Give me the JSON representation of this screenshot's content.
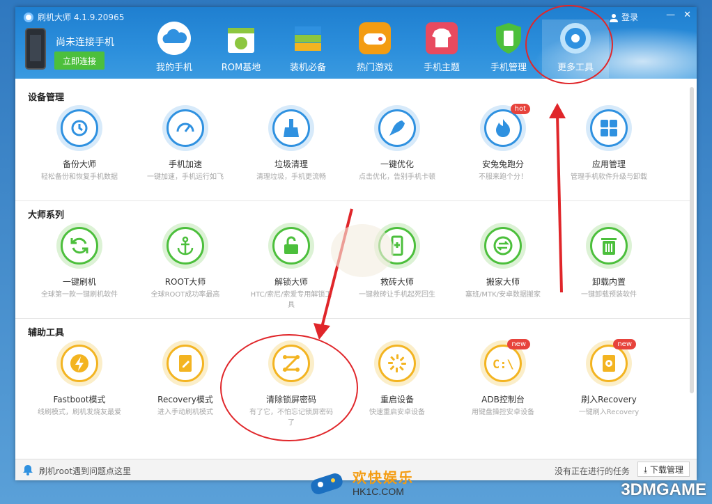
{
  "window": {
    "title": "刷机大师 4.1.9.20965",
    "login": "登录"
  },
  "device": {
    "status": "尚未连接手机",
    "connect_label": "立即连接"
  },
  "nav": [
    {
      "label": "我的手机",
      "icon": "cloud-icon"
    },
    {
      "label": "ROM基地",
      "icon": "rom-bag-icon"
    },
    {
      "label": "装机必备",
      "icon": "books-icon"
    },
    {
      "label": "热门游戏",
      "icon": "gamepad-icon"
    },
    {
      "label": "手机主题",
      "icon": "tshirt-icon"
    },
    {
      "label": "手机管理",
      "icon": "phone-shield-icon"
    },
    {
      "label": "更多工具",
      "icon": "wrench-icon"
    }
  ],
  "sections": [
    {
      "title": "设备管理",
      "color": "#2f91e0",
      "tools": [
        {
          "name": "备份大师",
          "desc": "轻松备份和恢复手机数据",
          "icon": "backup-icon"
        },
        {
          "name": "手机加速",
          "desc": "一键加速，手机运行如飞",
          "icon": "speedometer-icon"
        },
        {
          "name": "垃圾清理",
          "desc": "清理垃圾，手机更流畅",
          "icon": "broom-icon"
        },
        {
          "name": "一键优化",
          "desc": "点击优化，告别手机卡顿",
          "icon": "rocket-icon"
        },
        {
          "name": "安兔兔跑分",
          "desc": "不服来跑个分！",
          "icon": "flame-icon",
          "badge": "hot"
        },
        {
          "name": "应用管理",
          "desc": "管理手机软件升级与卸载",
          "icon": "app-grid-icon"
        }
      ]
    },
    {
      "title": "大师系列",
      "color": "#4cbf3c",
      "tools": [
        {
          "name": "一键刷机",
          "desc": "全球第一款一键刷机软件",
          "icon": "refresh-icon"
        },
        {
          "name": "ROOT大师",
          "desc": "全球ROOT成功率最高",
          "icon": "anchor-icon"
        },
        {
          "name": "解锁大师",
          "desc": "HTC/索尼/索爱专用解锁工具",
          "icon": "unlock-icon"
        },
        {
          "name": "救砖大师",
          "desc": "一键救砖让手机起死回生",
          "icon": "phone-plus-icon"
        },
        {
          "name": "搬家大师",
          "desc": "塞班/MTK/安卓数据搬家",
          "icon": "transfer-icon"
        },
        {
          "name": "卸载内置",
          "desc": "一键卸载预装软件",
          "icon": "trash-icon"
        }
      ]
    },
    {
      "title": "辅助工具",
      "color": "#f3b421",
      "tools": [
        {
          "name": "Fastboot模式",
          "desc": "线刷模式，刷机发烧友最爱",
          "icon": "bolt-icon"
        },
        {
          "name": "Recovery模式",
          "desc": "进入手动刷机模式",
          "icon": "tablet-edit-icon"
        },
        {
          "name": "清除锁屏密码",
          "desc": "有了它，不怕忘记锁屏密码了",
          "icon": "pattern-lock-icon"
        },
        {
          "name": "重启设备",
          "desc": "快速重启安卓设备",
          "icon": "reboot-icon"
        },
        {
          "name": "ADB控制台",
          "desc": "用键盘操控安卓设备",
          "icon": "terminal-icon",
          "badge": "new"
        },
        {
          "name": "刷入Recovery",
          "desc": "一键刷入Recovery",
          "icon": "flash-recovery-icon",
          "badge": "new"
        }
      ]
    }
  ],
  "footer": {
    "message": "刷机root遇到问题点这里",
    "tasks": "没有正在进行的任务",
    "download_label": "下载管理"
  },
  "watermarks": {
    "hk_title": "欢快娱乐",
    "hk_url": "HK1C.COM",
    "game": "3DMGAME"
  },
  "colors": {
    "header": "#2c8fdc",
    "blue": "#2f91e0",
    "green": "#4cbf3c",
    "yellow": "#f3b421",
    "annotation": "#e0262a"
  }
}
